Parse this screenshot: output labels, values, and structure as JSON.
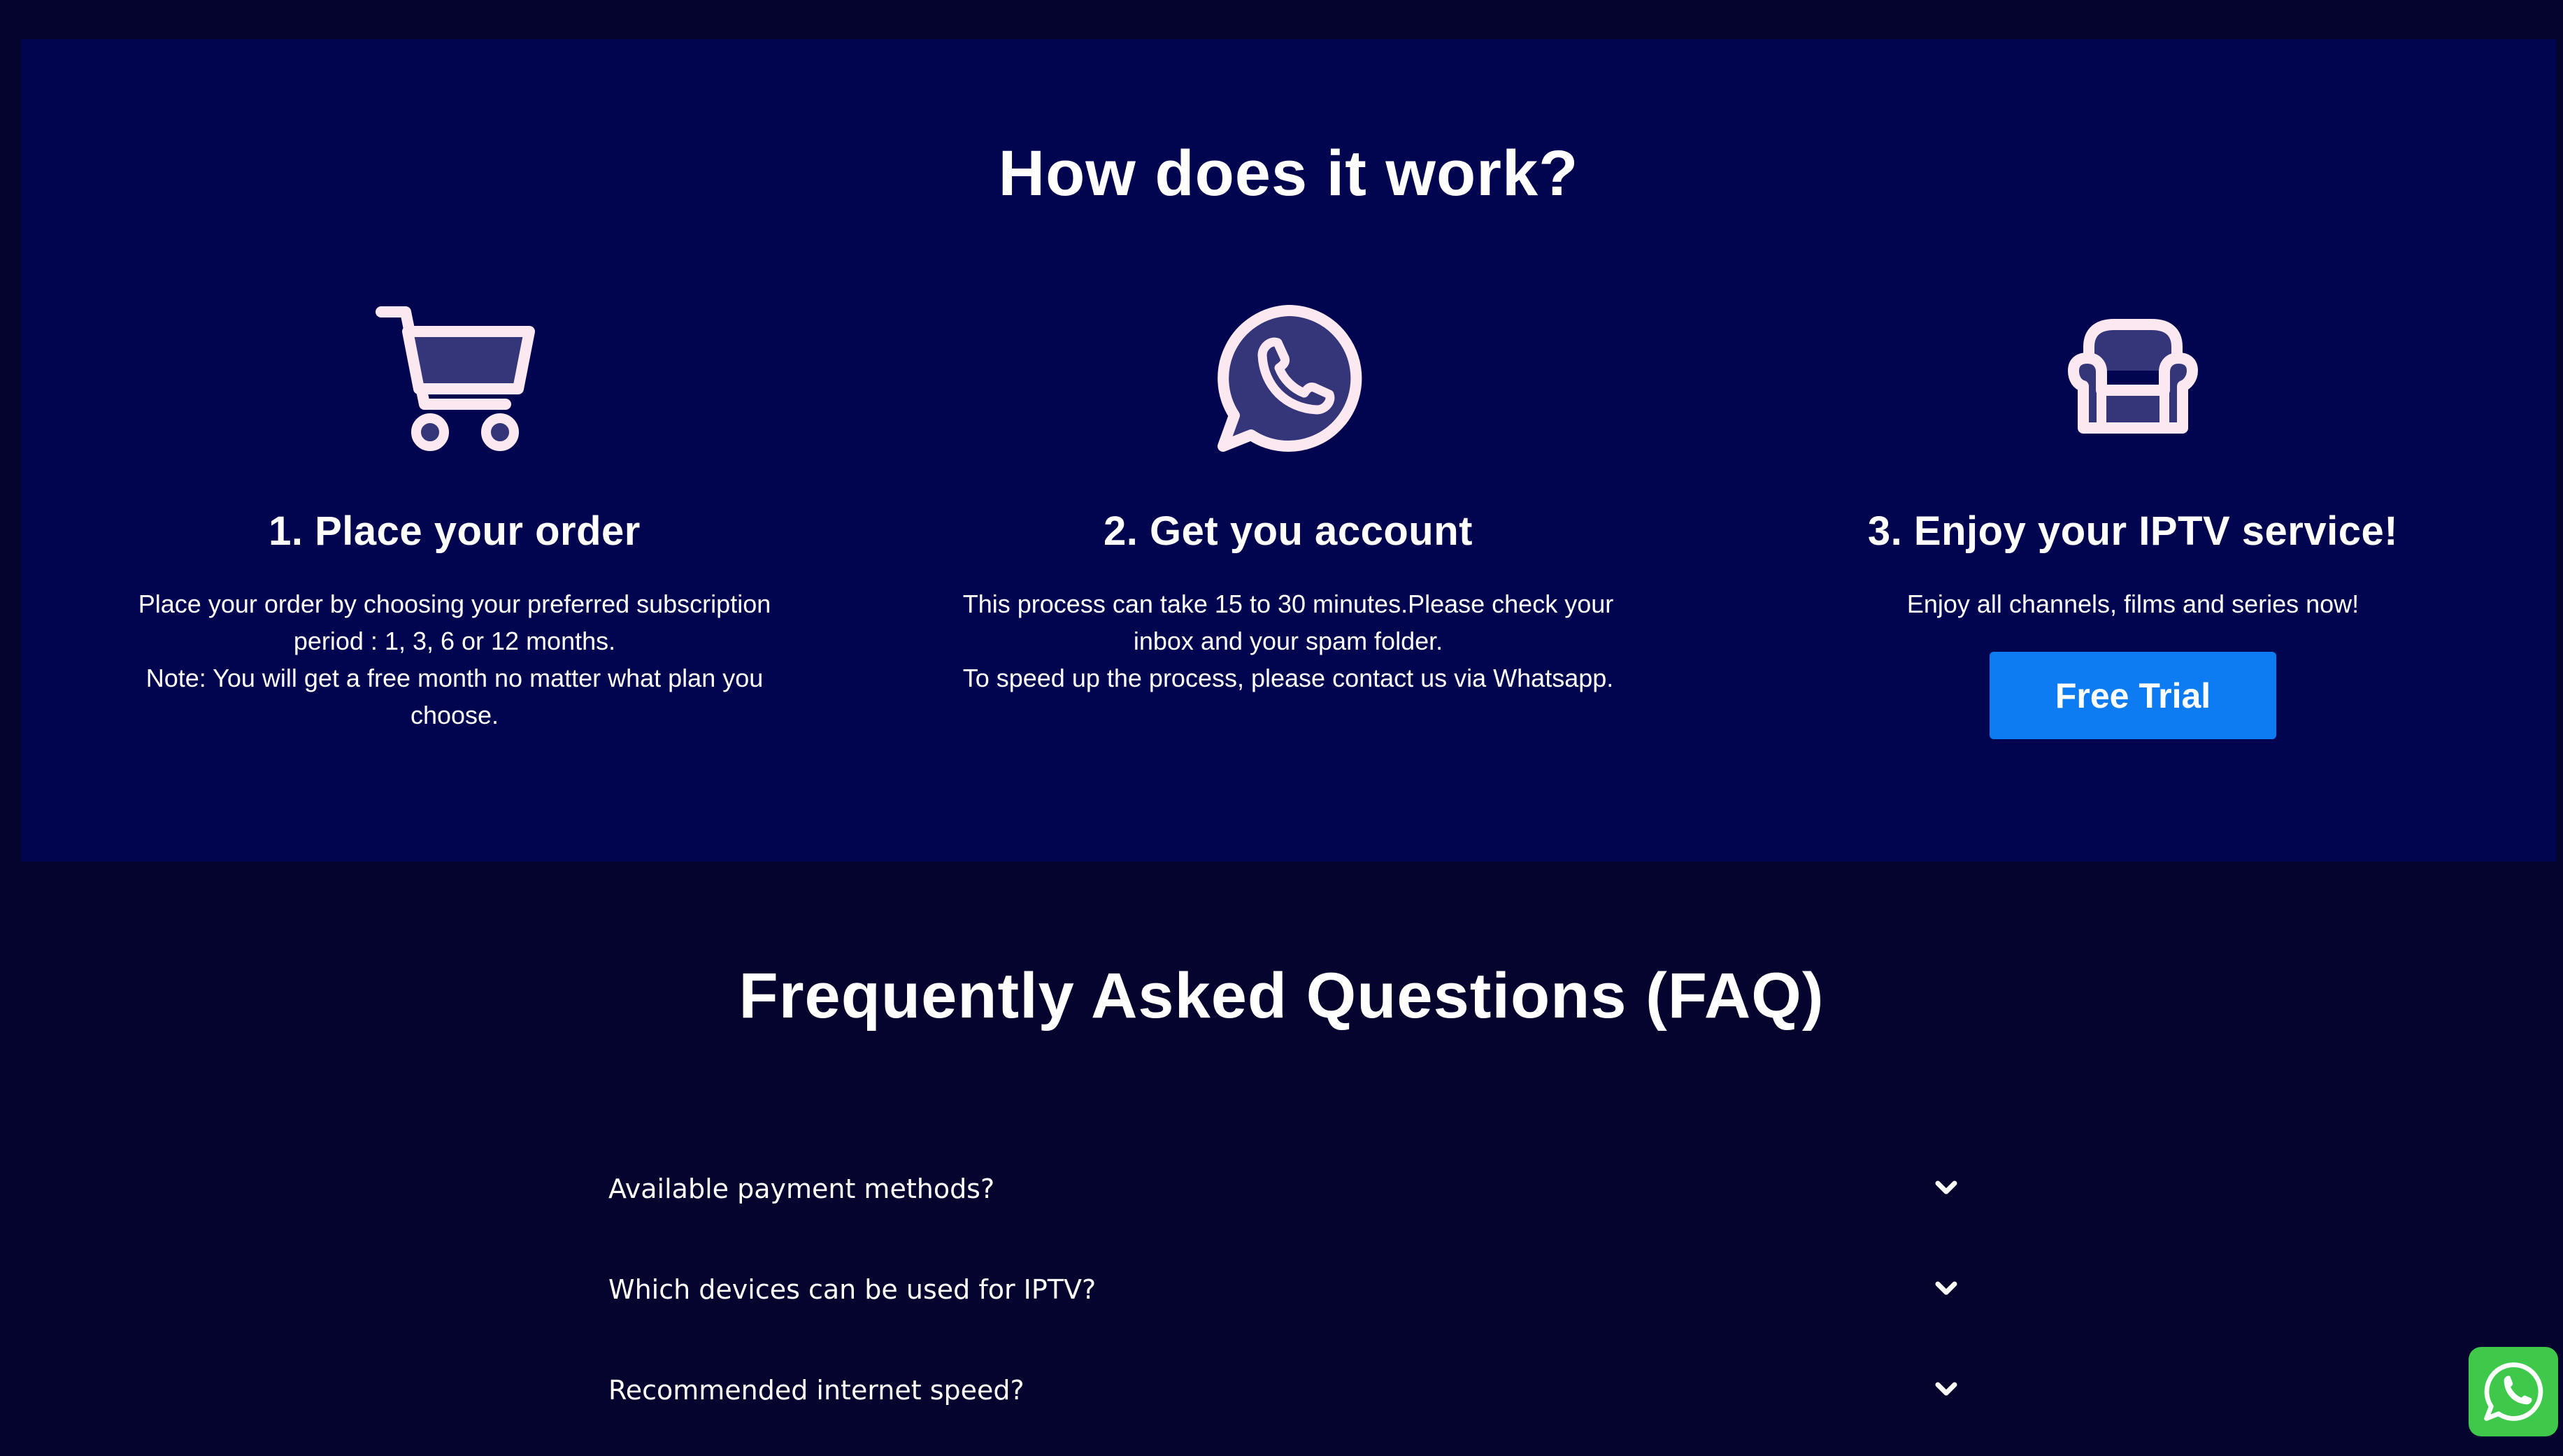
{
  "how_section": {
    "title": "How does it work?",
    "steps": [
      {
        "icon": "shopping-cart-icon",
        "title": "1. Place your order",
        "lines": [
          "Place your order by choosing your preferred subscription period : 1, 3, 6 or 12 months.",
          "Note: You will get a free month no matter what plan you choose."
        ]
      },
      {
        "icon": "whatsapp-icon",
        "title": "2. Get you account",
        "lines": [
          "This process can take 15 to 30 minutes.Please check your inbox and your spam folder.",
          "To speed up the process, please contact us via Whatsapp."
        ]
      },
      {
        "icon": "armchair-icon",
        "title": "3. Enjoy your IPTV service!",
        "lines": [
          "Enjoy all channels, films and series now!"
        ],
        "button_label": "Free Trial"
      }
    ]
  },
  "faq": {
    "title": "Frequently Asked Questions (FAQ)",
    "items": [
      "Available payment methods?",
      "Which devices can be used for IPTV?",
      "Recommended internet speed?"
    ]
  },
  "floating_button": {
    "icon": "whatsapp-icon"
  },
  "colors": {
    "page_bg": "#04042e",
    "section_bg": "#010550",
    "button_bg": "#0d7bf1",
    "icon_fill": "#35357a",
    "icon_stroke": "#fbe8f0",
    "whatsapp_green": "#3ec94a"
  }
}
